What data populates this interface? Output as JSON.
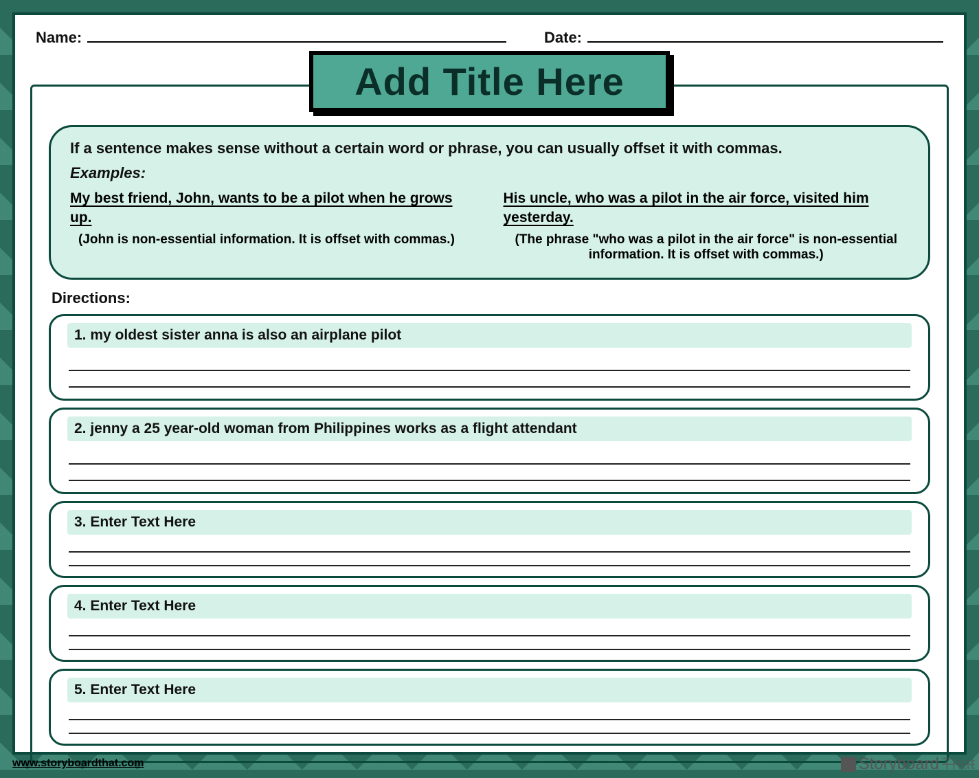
{
  "header": {
    "name_label": "Name:",
    "date_label": "Date:"
  },
  "title": "Add Title Here",
  "instruction": {
    "intro": "If a sentence makes sense without a certain word or phrase, you can usually offset it with commas.",
    "examples_label": "Examples:",
    "example1": {
      "sentence": "My best friend, John, wants to be a pilot when he grows up.",
      "note": "(John is non-essential information. It is offset with commas.)"
    },
    "example2": {
      "sentence": "His uncle, who was a pilot in the air force, visited him yesterday.",
      "note": "(The phrase \"who was a pilot in the air force\" is non-essential information. It is offset with commas.)"
    }
  },
  "directions_label": "Directions:",
  "questions": [
    {
      "text": "1. my oldest sister anna is also an airplane pilot"
    },
    {
      "text": "2. jenny a 25 year-old woman from Philippines works as a flight attendant"
    },
    {
      "text": "3. Enter Text Here"
    },
    {
      "text": "4. Enter Text Here"
    },
    {
      "text": "5. Enter Text Here"
    }
  ],
  "footer": {
    "url": "www.storyboardthat.com",
    "brand_left": "Storyboard",
    "brand_right": "That"
  }
}
